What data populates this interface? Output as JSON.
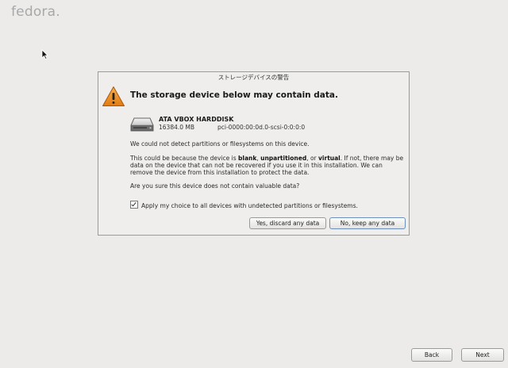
{
  "header": {
    "logo": "fedora."
  },
  "dialog": {
    "title": "ストレージデバイスの警告",
    "headline": "The storage device below may contain data.",
    "device": {
      "name": "ATA VBOX HARDDISK",
      "size": "16384.0 MB",
      "path": "pci-0000:00:0d.0-scsi-0:0:0:0"
    },
    "message1": "We could not detect partitions or filesystems on this device.",
    "message2": {
      "part1": "This could be because the device is ",
      "blank": "blank",
      "sep1": ", ",
      "unpartitioned": "unpartitioned",
      "sep2": ", or ",
      "virtual": "virtual",
      "part2": ". If not, there may be data on the device that can not be recovered if you use it in this installation. We can remove the device from this installation to protect the data."
    },
    "question": "Are you sure this device does not contain valuable data?",
    "checkbox": {
      "label": "Apply my choice to all devices with undetected partitions or filesystems.",
      "checked": true
    },
    "buttons": {
      "yes": "Yes, discard any data",
      "no": "No, keep any data"
    }
  },
  "footer": {
    "back": "Back",
    "next": "Next"
  },
  "icons": {
    "warning": "warning-triangle-icon",
    "disk": "hard-disk-icon",
    "cursor": "mouse-pointer-icon"
  }
}
